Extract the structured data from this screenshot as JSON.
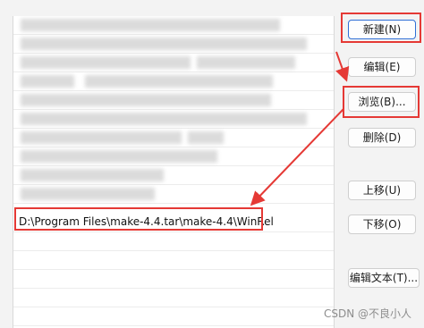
{
  "list": {
    "visible_rows": [
      {
        "text": "",
        "obscured": true
      },
      {
        "text": "",
        "obscured": true
      },
      {
        "text": "",
        "obscured": true
      },
      {
        "text": "",
        "obscured": true
      },
      {
        "text": "",
        "obscured": true
      },
      {
        "text": "",
        "obscured": true
      },
      {
        "text": "",
        "obscured": true
      },
      {
        "text": "",
        "obscured": true
      },
      {
        "text": "",
        "obscured": true
      },
      {
        "text": "",
        "obscured": true
      },
      {
        "text": "D:\\Program Files\\make-4.4.tar\\make-4.4\\WinRel",
        "obscured": false,
        "selected": true
      }
    ],
    "selected_value": "D:\\Program Files\\make-4.4.tar\\make-4.4\\WinRel"
  },
  "buttons": {
    "new": "新建(N)",
    "edit": "编辑(E)",
    "browse": "浏览(B)...",
    "delete": "删除(D)",
    "move_up": "上移(U)",
    "move_down": "下移(O)",
    "edit_text": "编辑文本(T)..."
  },
  "annotation_colors": {
    "highlight": "#e53935"
  },
  "watermark": "CSDN @不良小人"
}
